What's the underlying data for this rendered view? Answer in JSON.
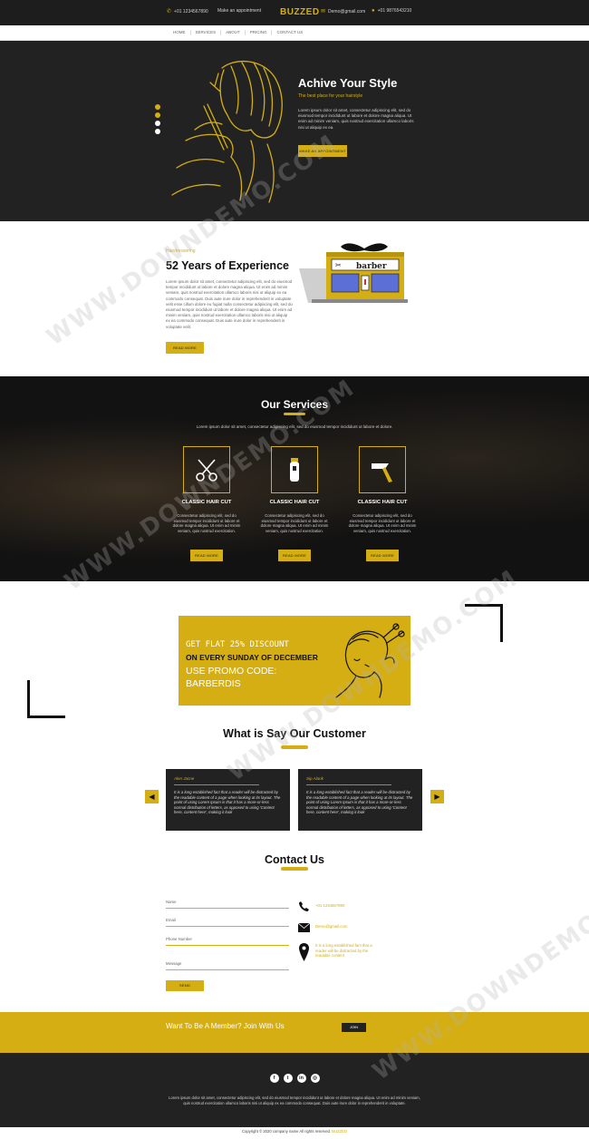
{
  "topbar": {
    "phone": "+01 1234567890",
    "appointment": "Make an appointment",
    "brand": "BUZZED",
    "email": "Demo@gmail.com",
    "phone2": "+01 9876543210"
  },
  "nav": [
    "HOME",
    "SERVICES",
    "ABOUT",
    "PRICING",
    "CONTACT US"
  ],
  "hero": {
    "title": "Achive Your Style",
    "subtitle": "The best place for your hairstyle",
    "text": "Lorem ipsum dolor sit amet, consectetur adipiscing elit, sed do eiusmod tempor incididunt ut labore et dolore magna aliqua. Ut enim ad minim veniam, quis nostrud exercitation ullamco laboris nisi ut aliquip ex ea.",
    "button": "MAKE AN APPOINTMENT"
  },
  "experience": {
    "kicker": "Hairdressering",
    "title": "52 Years of Experience",
    "text": "Lorem ipsum dolor sit amet, consectetur adipiscing elit, sed do eiusmod tempor incididunt ut labore et dolore magna aliqua. Ut enim ad minim veniam, quis nostrud exercitation ullamco laboris nisi ut aliquip ex ea commodo consequat. Duis aute irure dolor in reprehenderit in voluptate velit esse cillum dolore eu fugiat nulla consectetur adipiscing elit, sed do eiusmod tempor incididunt ut labore et dolore magna aliqua. Ut enim ad minim veniam, quis nostrud exercitation ullamco laboris nisi ut aliquip ex ea commodo consequat. Duis aute irure dolor in reprehenderit in voluptate velit.",
    "button": "READ MORE",
    "sign": "barber"
  },
  "services": {
    "title": "Our Services",
    "intro": "Lorem ipsum dolor sit amet, consectetur adipiscing elit, sed do eiusmod tempor incididunt ut labore et dolore.",
    "items": [
      {
        "icon": "scissors-icon",
        "title": "CLASSIC HAIR CUT",
        "text": "Consectetur adipiscing elit, sed do eiusmod tempor incididunt ut labore et dolore magna aliqua. Ut enim ad minim veniam, quis nostrud exercitation.",
        "button": "READ MORE"
      },
      {
        "icon": "trimmer-icon",
        "title": "CLASSIC HAIR CUT",
        "text": "Consectetur adipiscing elit, sed do eiusmod tempor incididunt ut labore et dolore magna aliqua. Ut enim ad minim veniam, quis nostrud exercitation.",
        "button": "READ MORE"
      },
      {
        "icon": "razor-icon",
        "title": "CLASSIC HAIR CUT",
        "text": "Consectetur adipiscing elit, sed do eiusmod tempor incididunt ut labore et dolore magna aliqua. Ut enim ad minim veniam, quis nostrud exercitation.",
        "button": "READ MORE"
      }
    ]
  },
  "promo": {
    "line1": "GET FLAT 25% DISCOUNT",
    "line2": "ON EVERY SUNDAY OF DECEMBER",
    "line3": "USE PROMO CODE:",
    "line4": "BARBERDIS"
  },
  "testimonials": {
    "title": "What is Say Our Customer",
    "prev": "◀",
    "next": "▶",
    "items": [
      {
        "name": "Alen Jacne",
        "quote": "It is a long established fact that a reader will be distracted by the readable content of a page when looking at its layout. The point of using Lorem Ipsum is that it has a more-or-less normal distribution of letters, as opposed to using 'Content here, content here', making it look"
      },
      {
        "name": "Sip Alank",
        "quote": "It is a long established fact that a reader will be distracted by the readable content of a page when looking at its layout. The point of using Lorem Ipsum is that it has a more-or-less normal distribution of letters, as opposed to using 'Content here, content here', making it look"
      }
    ]
  },
  "contact": {
    "title": "Contact Us",
    "fields": {
      "name": "Name",
      "email": "Email",
      "phone": "Phone Number",
      "message": "Message"
    },
    "button": "Send",
    "phone": "+01 1234567890",
    "email": "Demo@gmail.com",
    "address": "It is a long established fact that a reader will be distracted by the readable content"
  },
  "member": {
    "text": "Want To Be A Member? Join With Us",
    "button": "JOIN"
  },
  "footer": {
    "socials": [
      "f",
      "t",
      "in",
      "◎"
    ],
    "text": "Lorem ipsum dolor sit amet, consectetur adipiscing elit, sed do eiusmod tempor incididunt ut labore et dolore magna aliqua. Ut enim ad minim veniam, quis nostrud exercitation ullamco laboris nisi ut aliquip ex ea commodo consequat. Duis aute irure dolor in reprehenderit in voluptate.",
    "copyright": "Copyright © 2020 company name All rights reserved.",
    "copyright_brand": "BUZZED"
  },
  "watermark": "WWW.DOWNDEMO.COM",
  "colors": {
    "accent": "#d4ae13",
    "dark": "#222222",
    "black": "#121212"
  }
}
